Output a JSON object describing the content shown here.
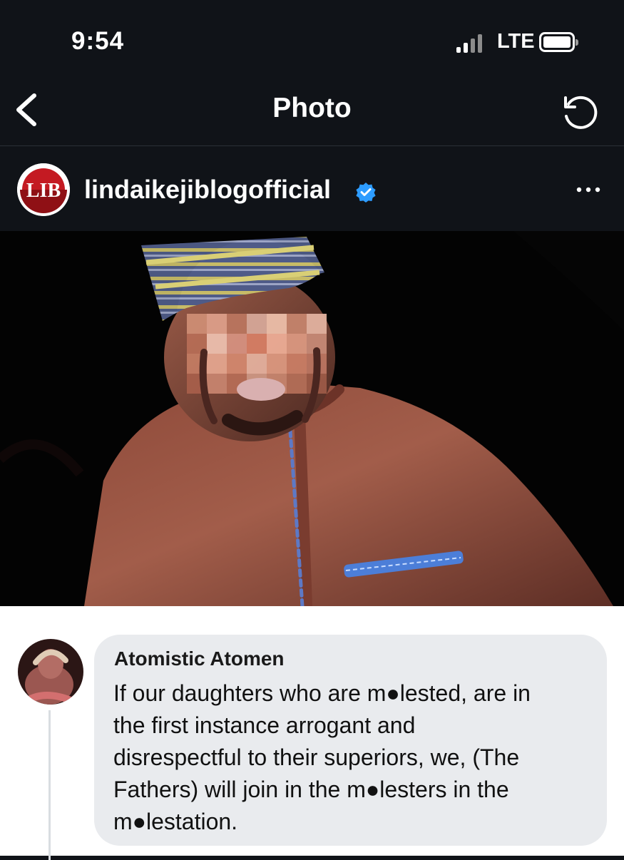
{
  "status_bar": {
    "time": "9:54",
    "network": "LTE",
    "signal_bars_filled": 2,
    "battery_icon": "battery-full-icon"
  },
  "nav": {
    "title": "Photo",
    "back_icon": "chevron-left-icon",
    "refresh_icon": "refresh-icon"
  },
  "post": {
    "account": {
      "avatar_text": "LIB",
      "username": "lindaikejiblogofficial",
      "verified": true,
      "more_icon": "more-horizontal-icon"
    }
  },
  "comment": {
    "author": "Atomistic Atomen",
    "lines": [
      "If our daughters who are m●lested, are in",
      "the first instance arrogant and",
      "disrespectful to their superiors, we, (The",
      "Fathers) will join in the m●lesters in the",
      "m●lestation."
    ]
  },
  "colors": {
    "background": "#101318",
    "text_primary": "#ffffff",
    "verified_blue": "#2d9cff",
    "brand_red": "#b5121b",
    "bubble_gray": "#e9ebee"
  }
}
